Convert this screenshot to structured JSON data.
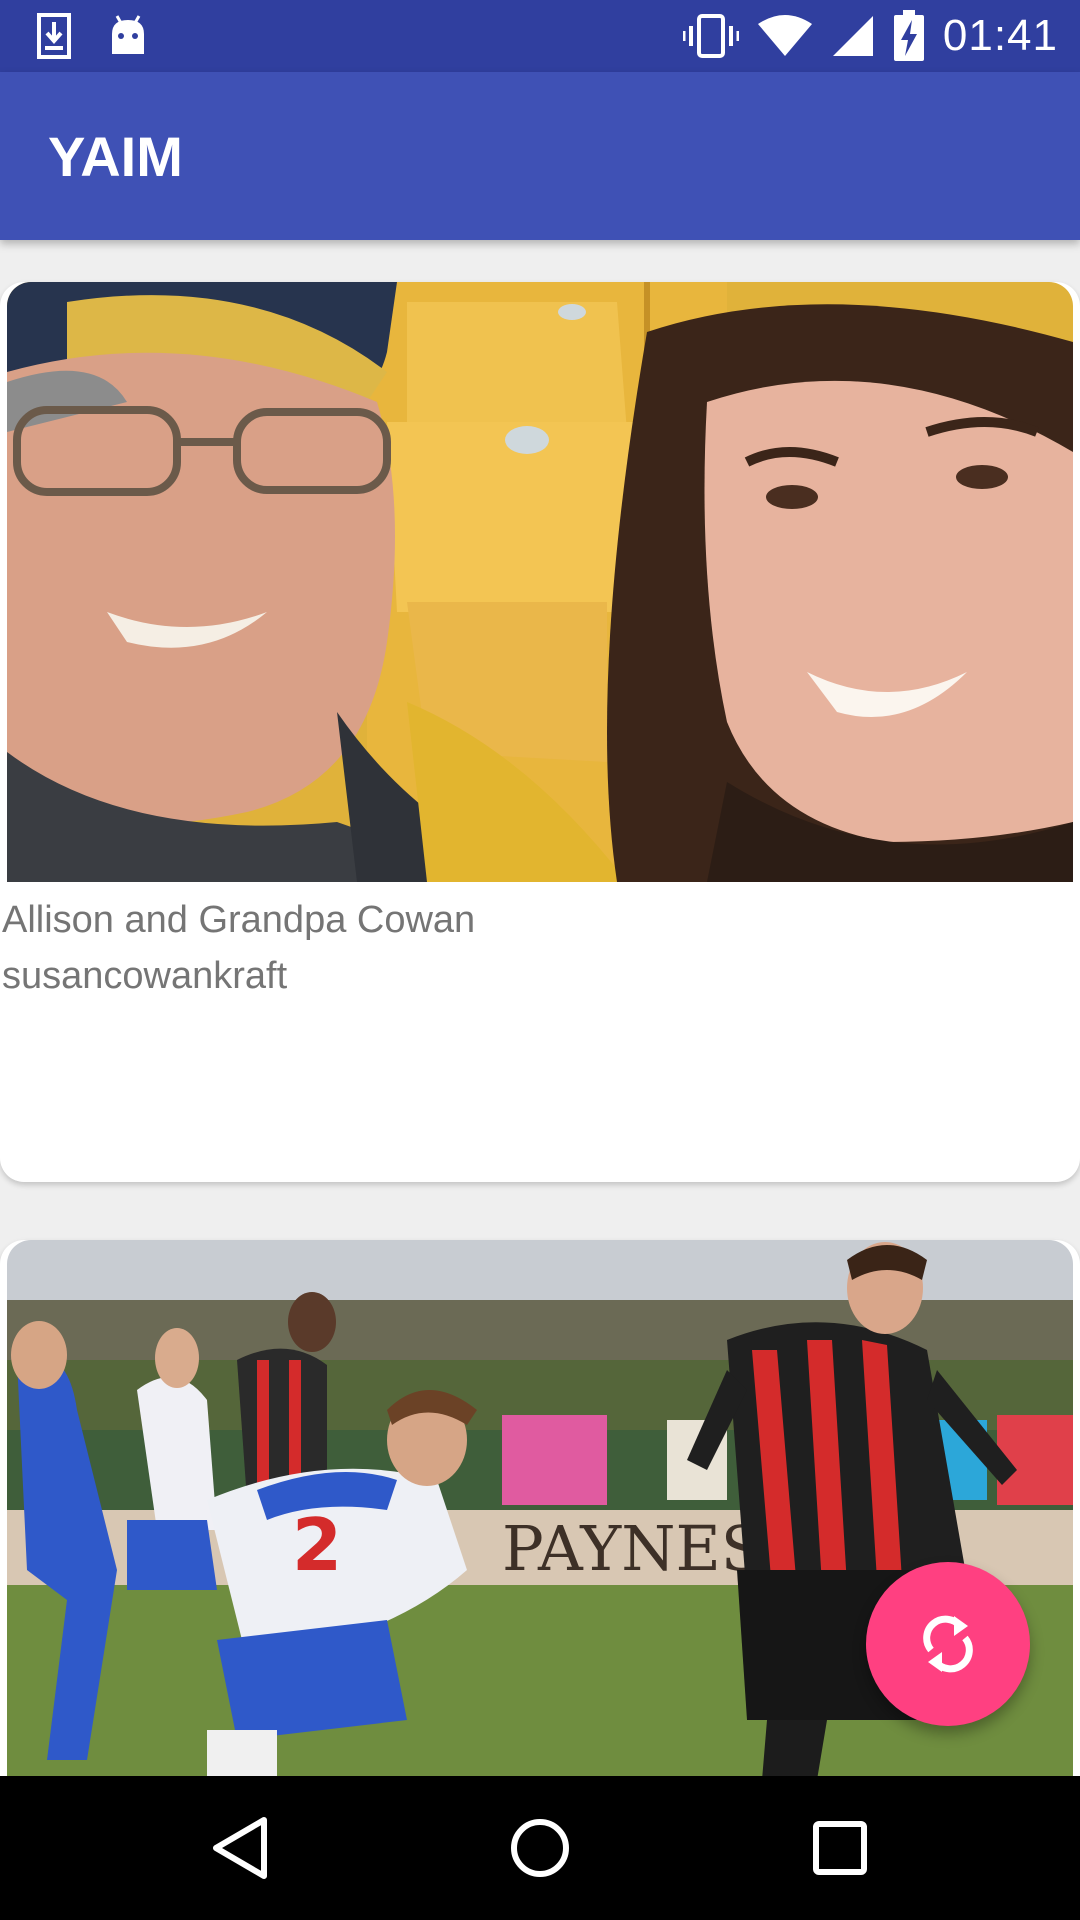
{
  "status_bar": {
    "time": "01:41",
    "icons": [
      "download-icon",
      "android-icon",
      "vibrate-icon",
      "wifi-icon",
      "signal-icon",
      "battery-charging-icon"
    ]
  },
  "app_bar": {
    "title": "YAIM"
  },
  "feed": {
    "cards": [
      {
        "image": "selfie-photo",
        "title": "Allison and Grandpa Cowan",
        "author": "susancowankraft"
      },
      {
        "image": "soccer-photo",
        "ad_board_text": "PAYNES"
      }
    ]
  },
  "fab": {
    "icon": "refresh-icon",
    "color": "#ff4081"
  },
  "navigation": {
    "icons": [
      "back-icon",
      "home-icon",
      "recents-icon"
    ]
  },
  "colors": {
    "status_bar": "#303f9f",
    "app_bar": "#3f51b5",
    "background": "#efefef",
    "caption_text": "#757575"
  }
}
